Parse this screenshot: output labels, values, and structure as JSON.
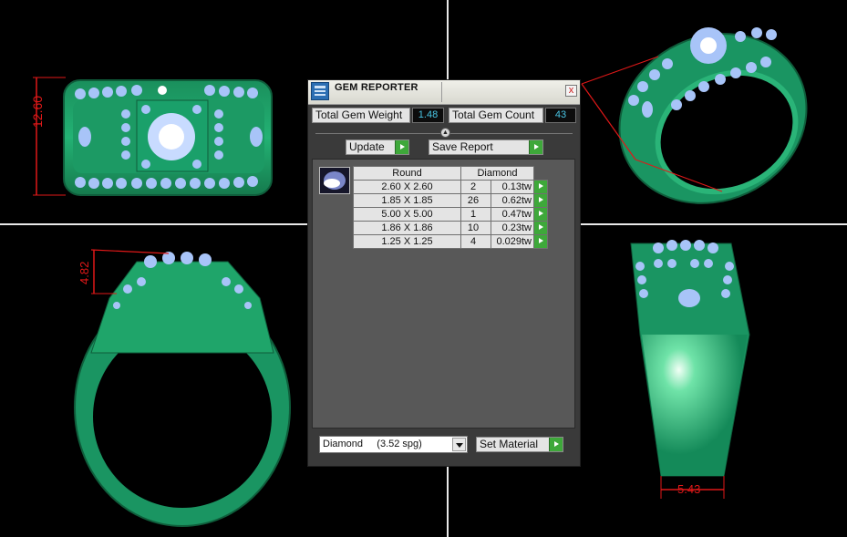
{
  "dimensions": {
    "width": "12.60",
    "height": "4.82",
    "shank": "5.43"
  },
  "gem_reporter": {
    "title": "GEM REPORTER",
    "close_glyph": "x",
    "total_gem_weight_label": "Total Gem Weight",
    "total_gem_weight_value": "1.48",
    "total_gem_count_label": "Total Gem Count",
    "total_gem_count_value": "43",
    "update_label": "Update",
    "save_report_label": "Save Report",
    "table": {
      "headers": [
        "Round",
        "Diamond"
      ],
      "rows": [
        {
          "size": "2.60 X 2.60",
          "qty": "2",
          "weight": "0.13tw"
        },
        {
          "size": "1.85 X 1.85",
          "qty": "26",
          "weight": "0.62tw"
        },
        {
          "size": "5.00 X 5.00",
          "qty": "1",
          "weight": "0.47tw"
        },
        {
          "size": "1.86 X 1.86",
          "qty": "10",
          "weight": "0.23tw"
        },
        {
          "size": "1.25 X 1.25",
          "qty": "4",
          "weight": "0.029tw"
        }
      ]
    },
    "material_select": "Diamond     (3.52 spg)",
    "set_material_label": "Set Material"
  },
  "colors": {
    "ring_green": "#1fa56a",
    "gem_blue": "#9ab8f6",
    "dimension_red": "#e01818",
    "value_cyan": "#49c6e5",
    "go_green": "#3ea83a"
  }
}
